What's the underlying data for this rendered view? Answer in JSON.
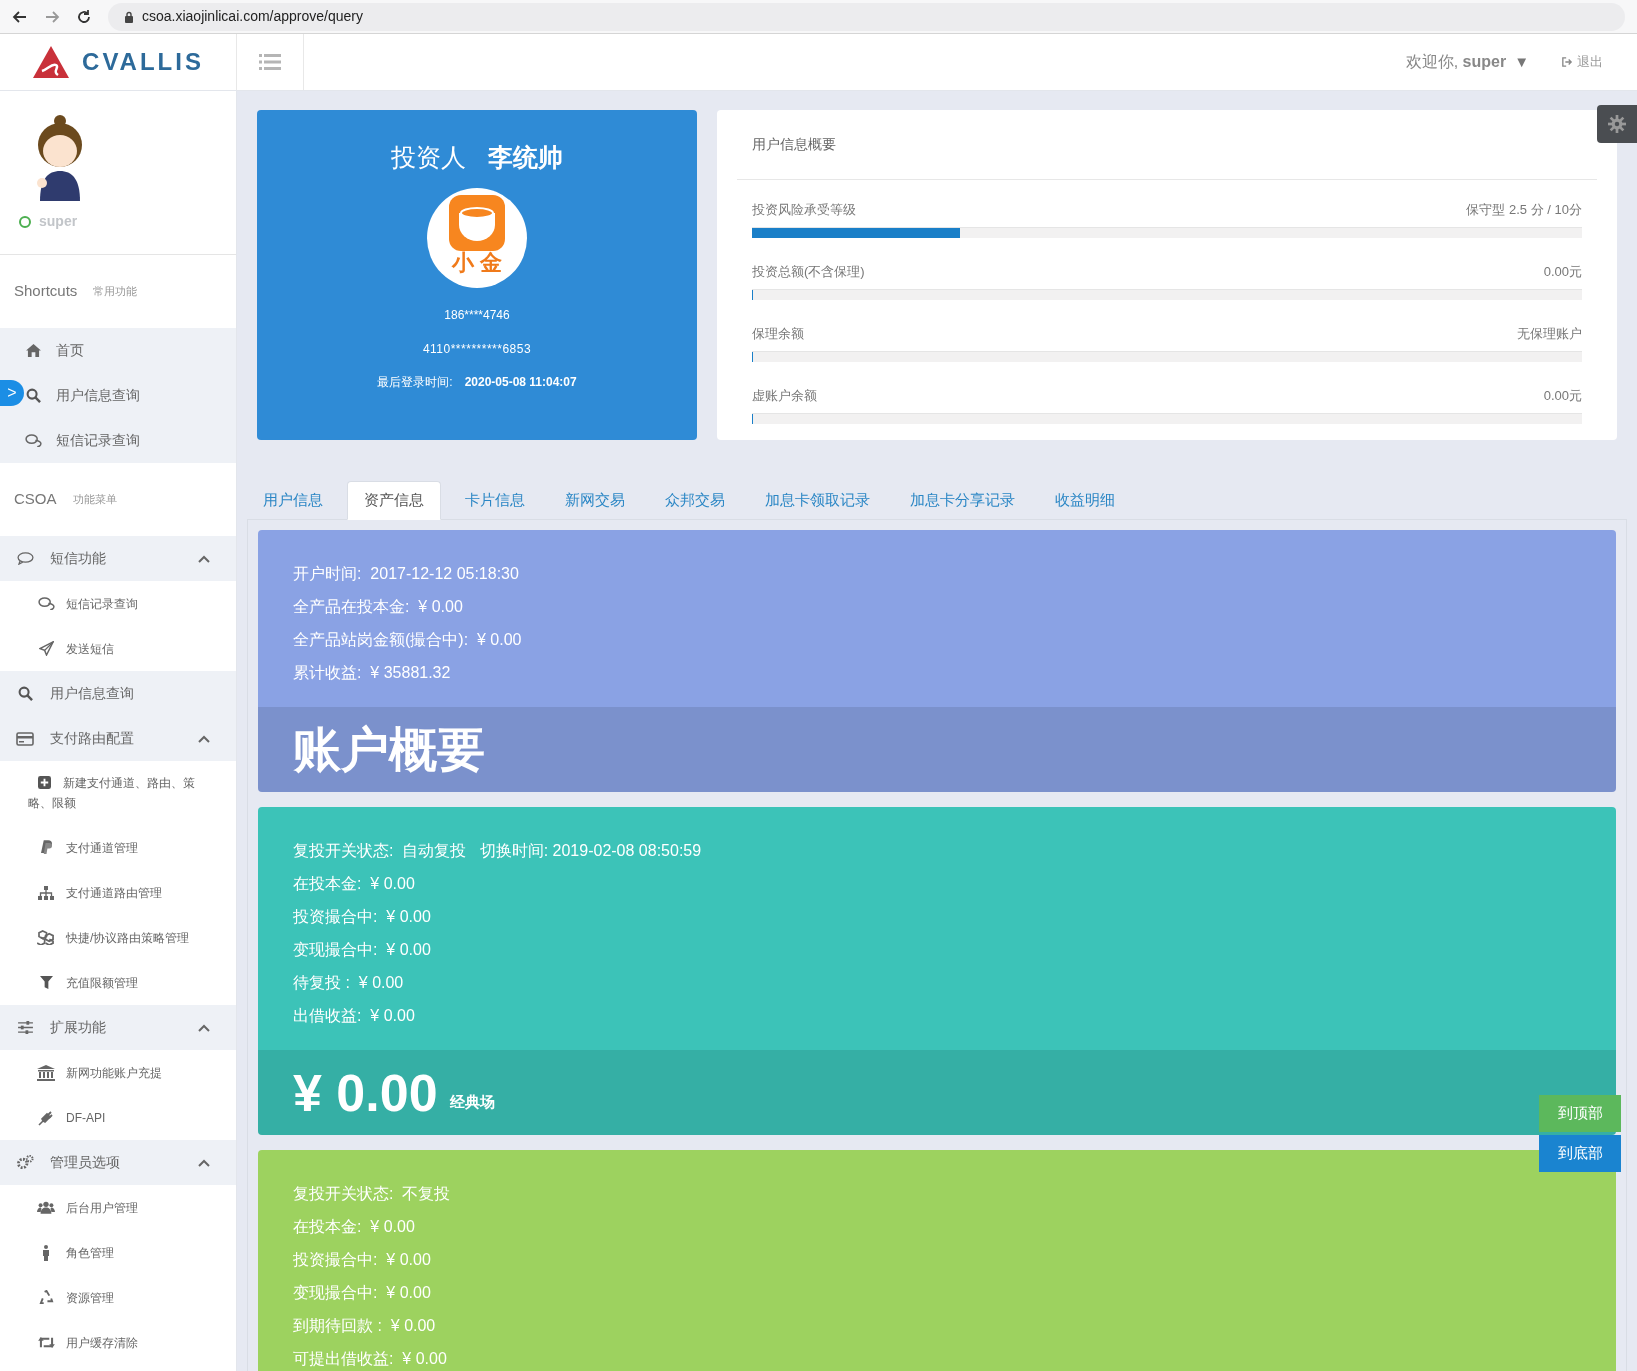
{
  "browser": {
    "url": "csoa.xiaojinlicai.com/approve/query"
  },
  "header": {
    "logo": "CVALLIS",
    "welcome": "欢迎你, **super**",
    "caret": "▼",
    "logout": "退出"
  },
  "sidebar": {
    "user": {
      "name": "super",
      "online": true
    },
    "shortcuts": {
      "title": "Shortcuts",
      "subtitle": "常用功能"
    },
    "shortcut_items": [
      {
        "label": "首页"
      },
      {
        "label": "用户信息查询"
      },
      {
        "label": "短信记录查询"
      }
    ],
    "menu": {
      "title": "CSOA",
      "subtitle": "功能菜单"
    },
    "groups": [
      {
        "label": "短信功能",
        "expanded": true,
        "children": [
          {
            "label": "短信记录查询"
          },
          {
            "label": "发送短信"
          }
        ]
      },
      {
        "label": "用户信息查询"
      },
      {
        "label": "支付路由配置",
        "expanded": true,
        "children": [
          {
            "label": "新建支付通道、路由、策略、限额"
          },
          {
            "label": "支付通道管理"
          },
          {
            "label": "支付通道路由管理"
          },
          {
            "label": "快捷/协议路由策略管理"
          },
          {
            "label": "充值限额管理"
          }
        ]
      },
      {
        "label": "扩展功能",
        "expanded": true,
        "children": [
          {
            "label": "新网功能账户充提"
          },
          {
            "label": "DF-API"
          }
        ]
      },
      {
        "label": "管理员选项",
        "expanded": true,
        "children": [
          {
            "label": "后台用户管理"
          },
          {
            "label": "角色管理"
          },
          {
            "label": "资源管理"
          },
          {
            "label": "用户缓存清除"
          }
        ]
      }
    ],
    "pull_tab": ">"
  },
  "profile": {
    "role": "投资人",
    "name": "李统帅",
    "logo_text": "小 金",
    "phone": "186****4746",
    "id_number": "4110**********6853",
    "last_login_label": "最后登录时间:",
    "last_login": "2020-05-08 11:04:07"
  },
  "overview": {
    "title": "用户信息概要",
    "rows": [
      {
        "label": "投资风险承受等级",
        "value": "保守型 2.5 分 / 10分",
        "level": 0.25
      },
      {
        "label": "投资总额(不含保理)",
        "value": "0.00元",
        "level": 0
      },
      {
        "label": "保理余额",
        "value": "无保理账户",
        "level": 0
      },
      {
        "label": "虚账户余额",
        "value": "0.00元",
        "level": 0
      }
    ]
  },
  "tabs": [
    {
      "label": "用户信息",
      "selected": false
    },
    {
      "label": "资产信息",
      "selected": true
    },
    {
      "label": "卡片信息",
      "selected": false
    },
    {
      "label": "新网交易",
      "selected": false
    },
    {
      "label": "众邦交易",
      "selected": false
    },
    {
      "label": "加息卡领取记录",
      "selected": false
    },
    {
      "label": "加息卡分享记录",
      "selected": false
    },
    {
      "label": "收益明细",
      "selected": false
    }
  ],
  "cards": [
    {
      "color": "#8aa2e4",
      "lines": [
        "开户时间:  2017-12-12 05:18:30",
        "全产品在投本金:  ¥ 0.00",
        "全产品站岗金额(撮合中):  ¥ 0.00",
        "累计收益:  ¥ 35881.32"
      ],
      "footer": {
        "kind": "title",
        "text": "账户概要"
      }
    },
    {
      "color": "#3cc3b8",
      "lines": [
        "复投开关状态:  自动复投   切换时间: 2019-02-08 08:50:59",
        "在投本金:  ¥ 0.00",
        "投资撮合中:  ¥ 0.00",
        "变现撮合中:  ¥ 0.00",
        "待复投 :  ¥ 0.00",
        "出借收益:  ¥ 0.00"
      ],
      "footer": {
        "kind": "amount",
        "text": "¥ 0.00",
        "suffix": "经典场"
      }
    },
    {
      "color": "#9dd25f",
      "lines": [
        "复投开关状态:  不复投",
        "在投本金:  ¥ 0.00",
        "投资撮合中:  ¥ 0.00",
        "变现撮合中:  ¥ 0.00",
        "到期待回款 :  ¥ 0.00",
        "可提出借收益:  ¥ 0.00"
      ]
    }
  ],
  "float_buttons": [
    {
      "label": "到顶部",
      "color": "#5cb85c"
    },
    {
      "label": "到底部",
      "color": "#1a84d0"
    }
  ]
}
